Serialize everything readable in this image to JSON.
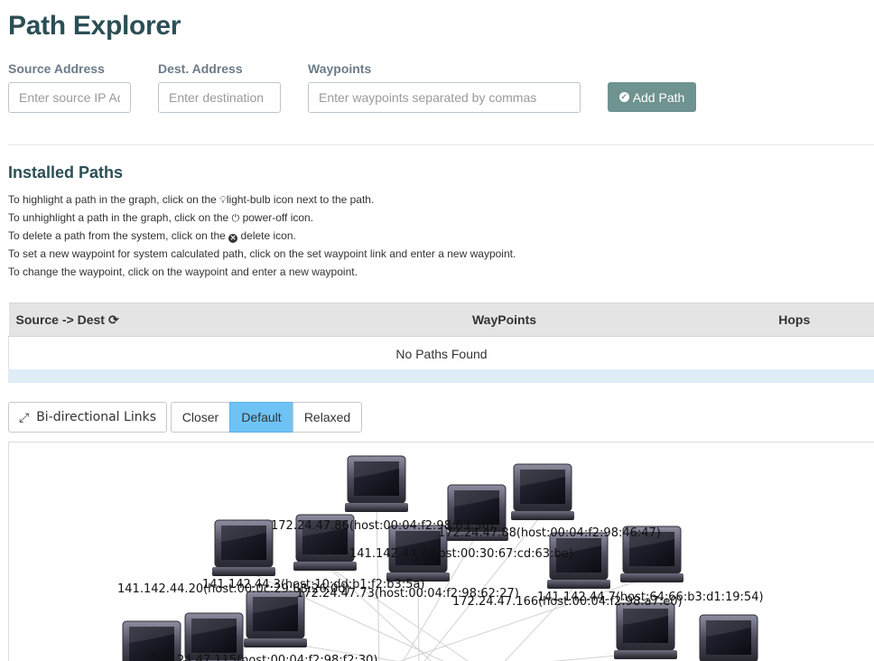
{
  "header": {
    "title": "Path Explorer"
  },
  "form": {
    "source": {
      "label": "Source Address",
      "placeholder": "Enter source IP Address"
    },
    "dest": {
      "label": "Dest. Address",
      "placeholder": "Enter destination"
    },
    "waypoints": {
      "label": "Waypoints",
      "placeholder": "Enter waypoints separated by commas"
    },
    "add_button": "Add Path"
  },
  "installed": {
    "title": "Installed Paths",
    "instructions": {
      "l1_a": "To highlight a path in the graph, click on the",
      "l1_b": "light-bulb icon next to the path.",
      "l2_a": "To unhighlight a path in the graph, click on the",
      "l2_b": "power-off icon.",
      "l3_a": "To delete a path from the system, click on the",
      "l3_b": "delete icon.",
      "l4": "To set a new waypoint for system calculated path, click on the set waypoint link and enter a new waypoint.",
      "l5": "To change the waypoint, click on the waypoint and enter a new waypoint."
    }
  },
  "table": {
    "columns": [
      "Source -> Dest",
      "WayPoints",
      "Hops"
    ],
    "empty_text": "No Paths Found"
  },
  "toolbar": {
    "bidir_label": "Bi-directional Links",
    "layouts": [
      "Closer",
      "Default",
      "Relaxed"
    ],
    "selected_layout": "Default"
  },
  "graph": {
    "nodes": [
      {
        "label": "172.24.47.86(host:00:04:f2:98:63:36)"
      },
      {
        "label": "172.24.47.88(host:00:04:f2:98:46:47)"
      },
      {
        "label": "141.142.44.?(host:00:30:67:cd:63:be)"
      },
      {
        "label": "141.142.44.3(host:10:dd:b1:f2:b3:5a)"
      },
      {
        "label": "141.142.44.20(host:00:0c:29:68:26:0d)"
      },
      {
        "label": "172.24.47.73(host:00:04:f2:98:62:27)"
      },
      {
        "label": "172.24.47.166(host:00:04:f2:98:a7:e0)"
      },
      {
        "label": "141.142.44.7(host:64:66:b3:d1:19:54)"
      },
      {
        "label": "172.24.47.115(host:00:04:f2:98:f2:30)"
      },
      {
        "label": ""
      },
      {
        "label": ""
      },
      {
        "label": ""
      },
      {
        "label": ""
      },
      {
        "label": ""
      },
      {
        "label": ""
      },
      {
        "label": ""
      }
    ]
  }
}
